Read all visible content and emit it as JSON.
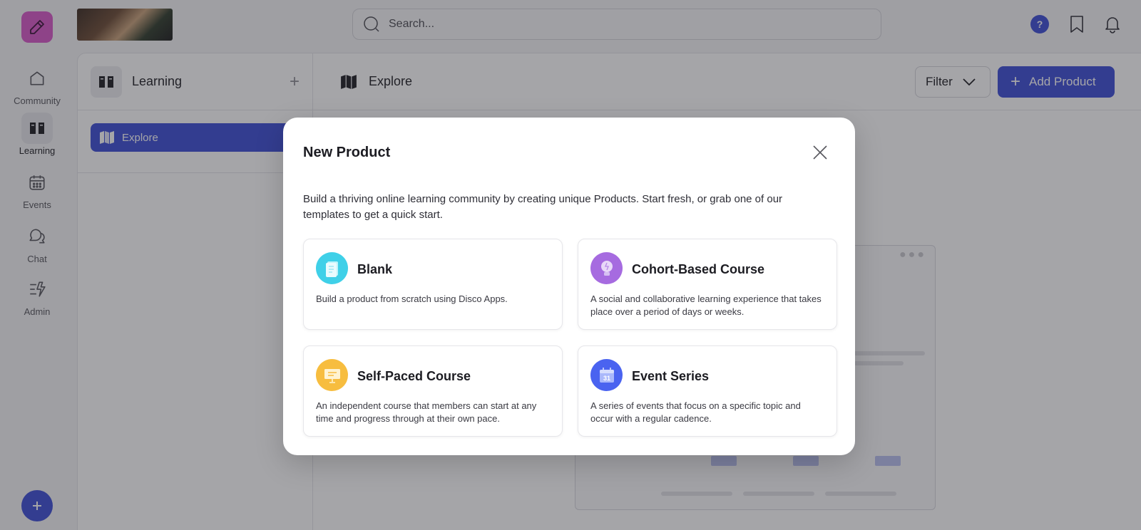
{
  "rail": {
    "items": [
      {
        "label": "Community",
        "icon": "home-icon"
      },
      {
        "label": "Learning",
        "icon": "book-icon",
        "active": true
      },
      {
        "label": "Events",
        "icon": "calendar-icon"
      },
      {
        "label": "Chat",
        "icon": "chat-icon"
      },
      {
        "label": "Admin",
        "icon": "admin-icon"
      }
    ]
  },
  "topbar": {
    "search_placeholder": "Search...",
    "help_label": "?"
  },
  "sidebar": {
    "title": "Learning",
    "nav_item": "Explore"
  },
  "main": {
    "title": "Explore",
    "filter_label": "Filter",
    "add_label": "Add Product"
  },
  "modal": {
    "title": "New Product",
    "description": "Build a thriving online learning community by creating unique Products. Start fresh, or grab one of our templates to get a quick start.",
    "cards": [
      {
        "title": "Blank",
        "description": "Build a product from scratch using Disco Apps.",
        "icon": "document-icon",
        "color": "#3fd0e8"
      },
      {
        "title": "Cohort-Based Course",
        "description": "A social and collaborative learning experience that takes place over a period of days or weeks.",
        "icon": "lightbulb-icon",
        "color": "#a66be0"
      },
      {
        "title": "Self-Paced Course",
        "description": "An independent course that members can start at any time and progress through at their own pace.",
        "icon": "presentation-icon",
        "color": "#f7bd3f"
      },
      {
        "title": "Event Series",
        "description": "A series of events that focus on a specific topic and occur with a regular cadence.",
        "icon": "calendar-31-icon",
        "color": "#4a63f0",
        "icon_text": "31"
      }
    ]
  },
  "colors": {
    "accent": "#3b4cd6",
    "logo": "#d757c9"
  }
}
